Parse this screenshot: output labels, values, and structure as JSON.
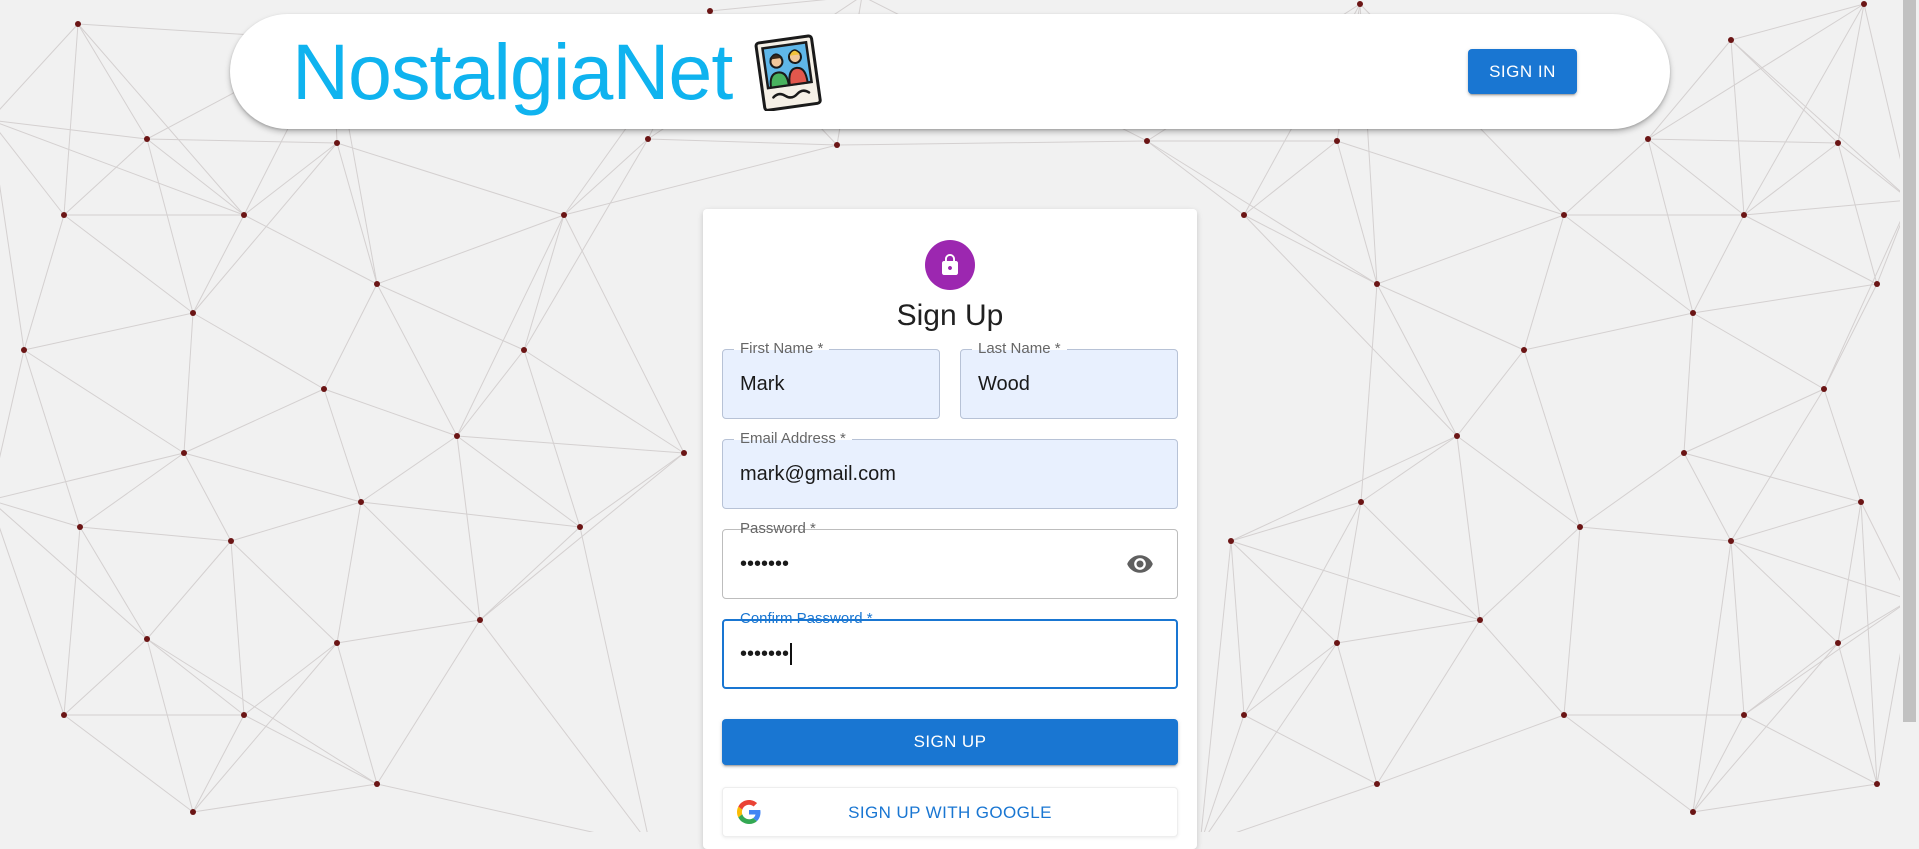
{
  "header": {
    "brand_name": "NostalgiaNet",
    "logo_icon": "polaroid-photo-icon",
    "signin_label": "SIGN IN"
  },
  "form": {
    "lock_icon": "lock-icon",
    "title": "Sign Up",
    "first_name": {
      "label": "First Name *",
      "value": "Mark"
    },
    "last_name": {
      "label": "Last Name *",
      "value": "Wood"
    },
    "email": {
      "label": "Email Address *",
      "value": "mark@gmail.com"
    },
    "password": {
      "label": "Password *",
      "value": "•••••••",
      "toggle_icon": "eye-icon"
    },
    "confirm_password": {
      "label": "Confirm Password *",
      "value": "•••••••"
    },
    "signup_label": "SIGN UP",
    "google_label": "SIGN UP WITH GOOGLE",
    "google_icon": "google-icon"
  },
  "colors": {
    "brand": "#0fb3ef",
    "primary": "#1976d2",
    "avatar": "#9c27b0",
    "background": "#f1f1f1",
    "network_node": "#6b1515",
    "network_line": "#d4d0d0"
  }
}
